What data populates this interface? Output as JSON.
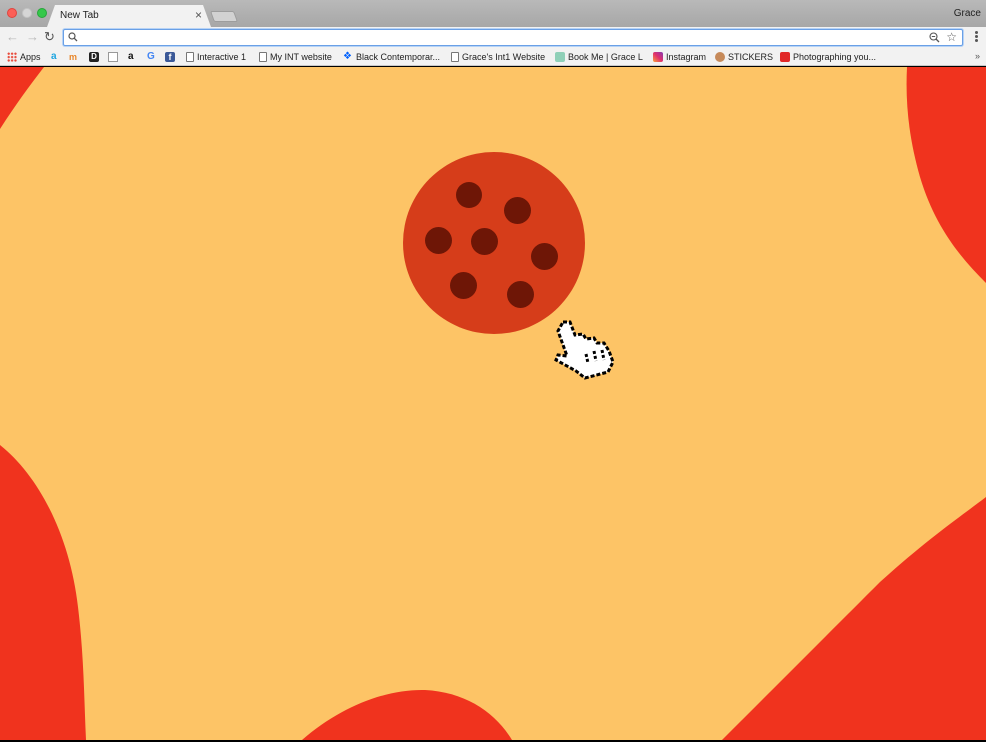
{
  "browser": {
    "tab": {
      "title": "New Tab",
      "close": "×"
    },
    "profile": "Grace",
    "address_bar": {
      "value": "",
      "placeholder": ""
    },
    "bookmarks": [
      {
        "label": "Apps",
        "icon": "apps-grid-icon"
      },
      {
        "label": "",
        "icon": "letter-a-icon"
      },
      {
        "label": "",
        "icon": "mn-icon"
      },
      {
        "label": "",
        "icon": "d-icon"
      },
      {
        "label": "",
        "icon": "photo-icon"
      },
      {
        "label": "",
        "icon": "amazon-icon"
      },
      {
        "label": "",
        "icon": "google-icon"
      },
      {
        "label": "",
        "icon": "facebook-icon"
      },
      {
        "label": "Interactive 1",
        "icon": "page-icon"
      },
      {
        "label": "My INT website",
        "icon": "page-icon"
      },
      {
        "label": "Black Contemporar...",
        "icon": "dropbox-icon"
      },
      {
        "label": "Grace's Int1 Website",
        "icon": "page-icon"
      },
      {
        "label": "Book Me | Grace L",
        "icon": "calendar-icon"
      },
      {
        "label": "Instagram",
        "icon": "instagram-icon"
      },
      {
        "label": "STICKERS",
        "icon": "sticker-icon"
      },
      {
        "label": "Photographing you...",
        "icon": "flipboard-icon"
      }
    ],
    "more": "»"
  },
  "page": {
    "background_color": "#fdc466",
    "blob_color": "#f0331e",
    "cookie_color": "#d63d1a",
    "chip_color": "#6e1606",
    "cursor": "pointer-hand-icon"
  }
}
